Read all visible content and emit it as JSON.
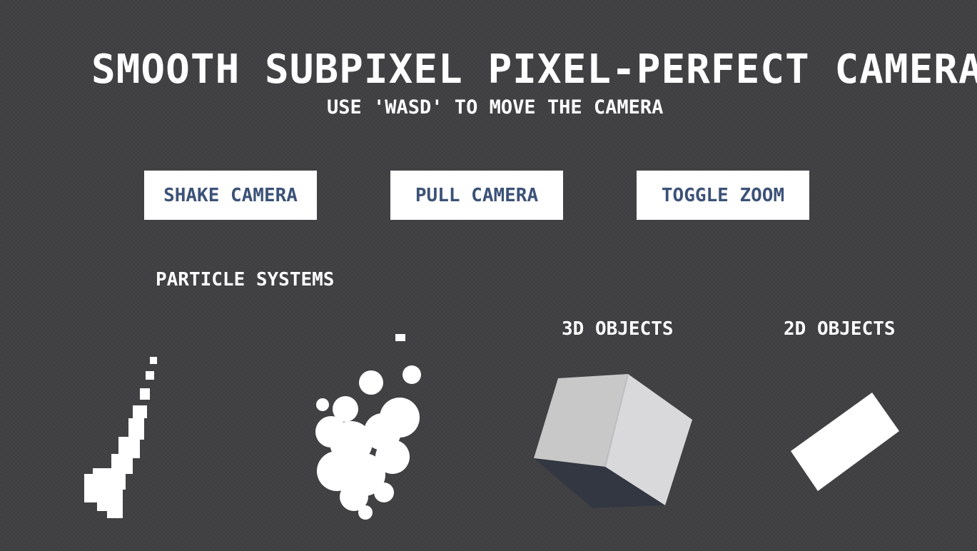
{
  "header": {
    "title": "SMOOTH SUBPIXEL PIXEL-PERFECT CAMERA",
    "subtitle": "USE 'WASD' TO MOVE THE CAMERA"
  },
  "buttons": {
    "shake": "SHAKE CAMERA",
    "pull": "PULL CAMERA",
    "zoom": "TOGGLE ZOOM"
  },
  "sections": {
    "particles": "PARTICLE SYSTEMS",
    "objects3d": "3D OBJECTS",
    "objects2d": "2D OBJECTS"
  },
  "colors": {
    "background": "#434346",
    "button_bg": "#ffffff",
    "button_text": "#3c5277",
    "cube_top": "#c8c8c8",
    "cube_right": "#d9d9dc",
    "cube_bottom": "#333741"
  }
}
